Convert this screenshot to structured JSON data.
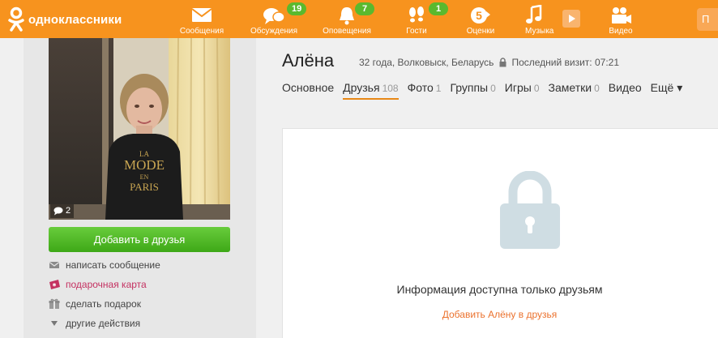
{
  "brand": {
    "name": "одноклассники"
  },
  "nav": [
    {
      "label": "Сообщения",
      "icon": "envelope-icon",
      "badge": ""
    },
    {
      "label": "Обсуждения",
      "icon": "chat-bubbles-icon",
      "badge": "19"
    },
    {
      "label": "Оповещения",
      "icon": "bell-icon",
      "badge": "7"
    },
    {
      "label": "Гости",
      "icon": "footprints-icon",
      "badge": "1"
    },
    {
      "label": "Оценки",
      "icon": "rating-five-icon",
      "badge": ""
    },
    {
      "label": "Музыка",
      "icon": "music-note-icon",
      "badge": ""
    },
    {
      "label": "Видео",
      "icon": "video-camera-icon",
      "badge": ""
    }
  ],
  "search": {
    "label": "П"
  },
  "profile": {
    "name": "Алёна",
    "details": "32 года, Волковыск, Беларусь",
    "last_visit": "Последний визит: 07:21",
    "photo_comments": "2",
    "shirt_text": [
      "LA",
      "MODE",
      "EN",
      "PARIS"
    ]
  },
  "sidebar": {
    "add_friend": "Добавить в друзья",
    "actions": [
      {
        "label": "написать сообщение",
        "icon": "envelope-icon"
      },
      {
        "label": "подарочная карта",
        "icon": "gift-card-icon"
      },
      {
        "label": "сделать подарок",
        "icon": "gift-box-icon"
      },
      {
        "label": "другие действия",
        "icon": "triangle-down-icon"
      }
    ]
  },
  "tabs": [
    {
      "label": "Основное",
      "count": ""
    },
    {
      "label": "Друзья",
      "count": "108"
    },
    {
      "label": "Фото",
      "count": "1"
    },
    {
      "label": "Группы",
      "count": "0"
    },
    {
      "label": "Игры",
      "count": "0"
    },
    {
      "label": "Заметки",
      "count": "0"
    },
    {
      "label": "Видео",
      "count": ""
    },
    {
      "label": "Ещё ▾",
      "count": ""
    }
  ],
  "panel": {
    "info": "Информация доступна только друзьям",
    "add_link": "Добавить Алёну в друзья"
  },
  "colors": {
    "topbar": "#f7931e",
    "badge": "#5ab92e",
    "add_button": "#4fb928",
    "link": "#eb722e",
    "gift": "#c43161",
    "lock": "#cfdde3"
  }
}
